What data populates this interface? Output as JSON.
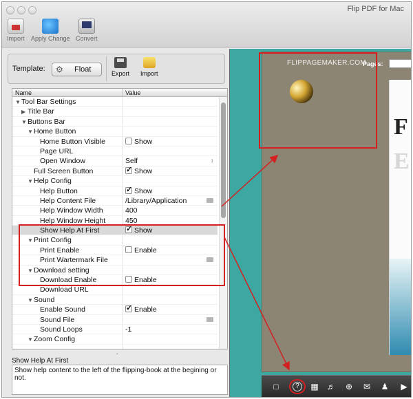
{
  "window": {
    "title": "Flip PDF for Mac"
  },
  "toolbar": {
    "import_label": "Import",
    "apply_label": "Apply Change",
    "convert_label": "Convert"
  },
  "template": {
    "label": "Template:",
    "value": "Float",
    "export_label": "Export",
    "import_label": "Import"
  },
  "grid": {
    "col_name": "Name",
    "col_value": "Value",
    "rows": [
      {
        "name": "Tool Bar Settings",
        "indent": 0,
        "tri": "down",
        "val": "",
        "ctrl": "none"
      },
      {
        "name": "Title Bar",
        "indent": 1,
        "tri": "right",
        "val": "",
        "ctrl": "none"
      },
      {
        "name": "Buttons Bar",
        "indent": 1,
        "tri": "down",
        "val": "",
        "ctrl": "none"
      },
      {
        "name": "Home Button",
        "indent": 2,
        "tri": "down",
        "val": "",
        "ctrl": "none"
      },
      {
        "name": "Home Button Visible",
        "indent": 4,
        "tri": "",
        "val": "Show",
        "ctrl": "checkbox",
        "checked": false
      },
      {
        "name": "Page URL",
        "indent": 4,
        "tri": "",
        "val": "",
        "ctrl": "none"
      },
      {
        "name": "Open Window",
        "indent": 4,
        "tri": "",
        "val": "Self",
        "ctrl": "select"
      },
      {
        "name": "Full Screen Button",
        "indent": 3,
        "tri": "",
        "val": "Show",
        "ctrl": "checkbox",
        "checked": true
      },
      {
        "name": "Help Config",
        "indent": 2,
        "tri": "down",
        "val": "",
        "ctrl": "none"
      },
      {
        "name": "Help Button",
        "indent": 4,
        "tri": "",
        "val": "Show",
        "ctrl": "checkbox",
        "checked": true
      },
      {
        "name": "Help Content File",
        "indent": 4,
        "tri": "",
        "val": "/Library/Application",
        "ctrl": "file"
      },
      {
        "name": "Help Window Width",
        "indent": 4,
        "tri": "",
        "val": "400",
        "ctrl": "text"
      },
      {
        "name": "Help Window Height",
        "indent": 4,
        "tri": "",
        "val": "450",
        "ctrl": "text"
      },
      {
        "name": "Show Help At First",
        "indent": 4,
        "tri": "",
        "val": "Show",
        "ctrl": "checkbox",
        "checked": true,
        "selected": true
      },
      {
        "name": "Print Config",
        "indent": 2,
        "tri": "down",
        "val": "",
        "ctrl": "none"
      },
      {
        "name": "Print Enable",
        "indent": 4,
        "tri": "",
        "val": "Enable",
        "ctrl": "checkbox",
        "checked": false
      },
      {
        "name": "Print Wartermark File",
        "indent": 4,
        "tri": "",
        "val": "",
        "ctrl": "file"
      },
      {
        "name": "Download setting",
        "indent": 2,
        "tri": "down",
        "val": "",
        "ctrl": "none"
      },
      {
        "name": "Download Enable",
        "indent": 4,
        "tri": "",
        "val": "Enable",
        "ctrl": "checkbox",
        "checked": false
      },
      {
        "name": "Download URL",
        "indent": 4,
        "tri": "",
        "val": "",
        "ctrl": "none"
      },
      {
        "name": "Sound",
        "indent": 2,
        "tri": "down",
        "val": "",
        "ctrl": "none"
      },
      {
        "name": "Enable Sound",
        "indent": 4,
        "tri": "",
        "val": "Enable",
        "ctrl": "checkbox",
        "checked": true
      },
      {
        "name": "Sound File",
        "indent": 4,
        "tri": "",
        "val": "",
        "ctrl": "file"
      },
      {
        "name": "Sound Loops",
        "indent": 4,
        "tri": "",
        "val": "-1",
        "ctrl": "text"
      },
      {
        "name": "Zoom Config",
        "indent": 2,
        "tri": "down",
        "val": "",
        "ctrl": "none"
      }
    ]
  },
  "description": {
    "title": "Show Help At First",
    "text": "Show help content to the left of the flipping-book at the begining or not."
  },
  "preview": {
    "site": "FLIPPAGEMAKER.COM",
    "pages_label": "Pages:",
    "page_letters": [
      "F",
      "E"
    ]
  },
  "colors": {
    "annotation": "#d42020",
    "preview_bg": "#3da8a2",
    "book_bg": "#8c8574"
  }
}
